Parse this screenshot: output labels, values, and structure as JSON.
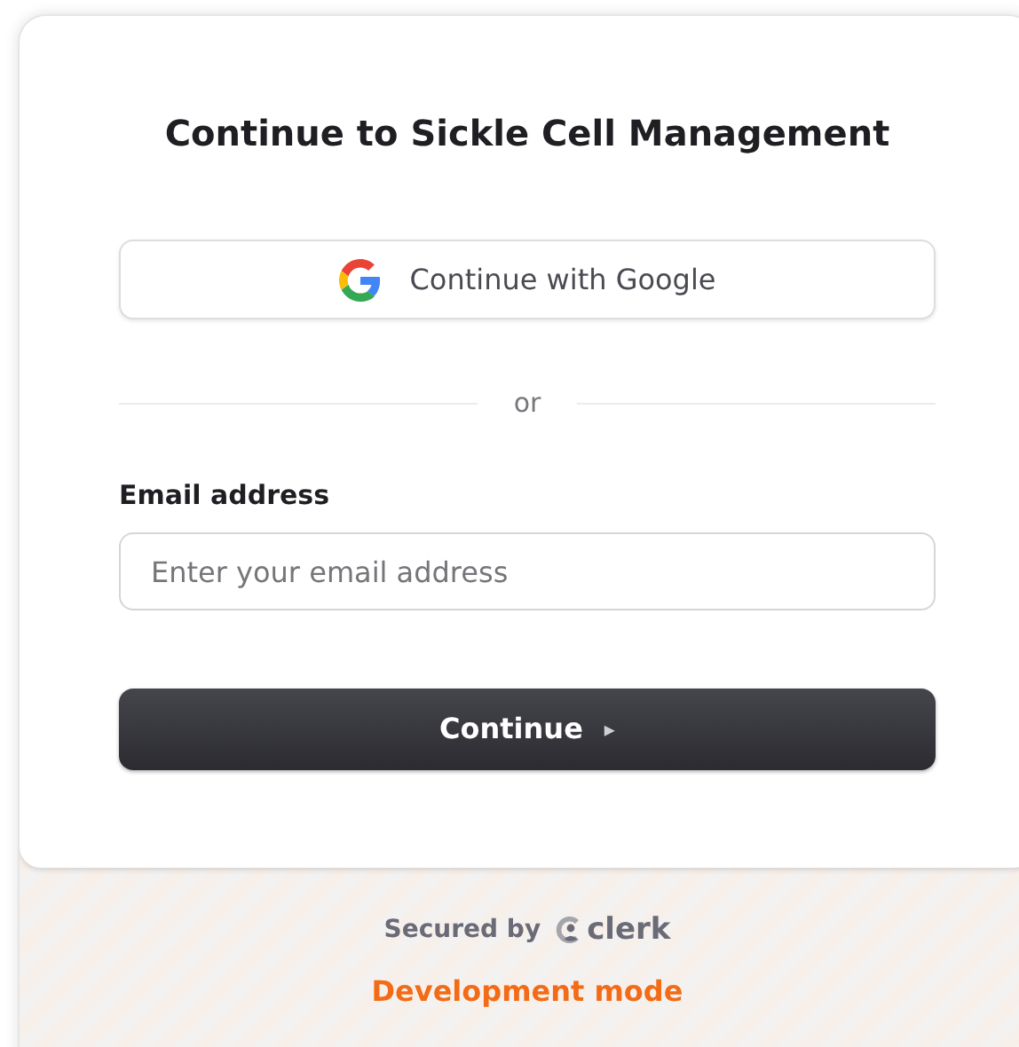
{
  "title": "Continue to Sickle Cell Management",
  "google_button": {
    "label": "Continue with Google"
  },
  "divider": {
    "label": "or"
  },
  "email_field": {
    "label": "Email address",
    "placeholder": "Enter your email address"
  },
  "continue_button": {
    "label": "Continue",
    "icon": "▸"
  },
  "footer": {
    "secured_by": "Secured by",
    "brand": "clerk",
    "mode": "Development mode"
  }
}
